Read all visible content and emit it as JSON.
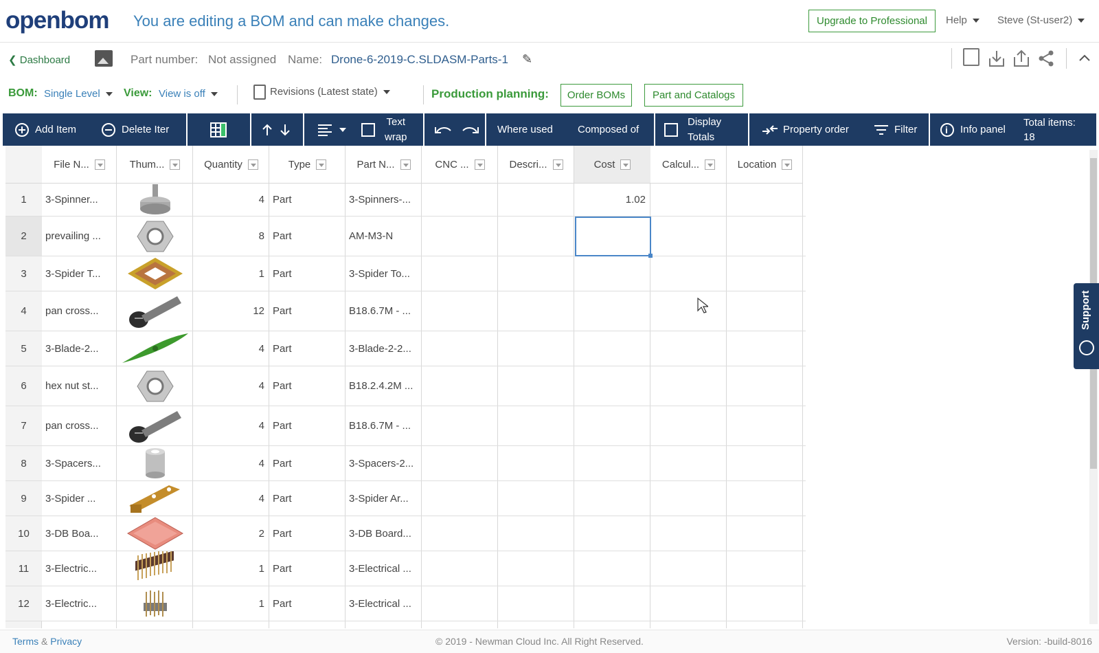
{
  "header": {
    "logo": "openbom",
    "message": "You are editing a BOM and can make changes.",
    "upgrade_label": "Upgrade to Professional",
    "help_label": "Help",
    "user_label": "Steve (St-user2)"
  },
  "info": {
    "dashboard_label": "Dashboard",
    "part_number_label": "Part number:",
    "part_number_value": "Not assigned",
    "name_label": "Name:",
    "name_value": "Drone-6-2019-C.SLDASM-Parts-1"
  },
  "controls": {
    "bom_label": "BOM:",
    "bom_value": "Single Level",
    "view_label": "View:",
    "view_value": "View is off",
    "revisions_label": "Revisions (Latest state)",
    "production_label": "Production planning:",
    "order_boms_label": "Order BOMs",
    "part_catalogs_label": "Part and Catalogs"
  },
  "toolbar": {
    "add_item": "Add Item",
    "delete_item": "Delete Iter",
    "text_wrap_1": "Text",
    "text_wrap_2": "wrap",
    "where_used": "Where used",
    "composed_of": "Composed of",
    "display_totals_1": "Display",
    "display_totals_2": "Totals",
    "property_order": "Property order",
    "filter": "Filter",
    "info_panel": "Info panel",
    "total_items_label": "Total items:",
    "total_items_value": "18"
  },
  "table": {
    "columns": [
      "File N...",
      "Thum...",
      "Quantity",
      "Type",
      "Part N...",
      "CNC ...",
      "Descri...",
      "Cost",
      "Calcul...",
      "Location"
    ],
    "rows": [
      {
        "num": "1",
        "file": "3-Spinner...",
        "qty": "4",
        "type": "Part",
        "part": "3-Spinners-...",
        "cost": "1.02",
        "thumb": "spinner"
      },
      {
        "num": "2",
        "file": "prevailing ...",
        "qty": "8",
        "type": "Part",
        "part": "AM-M3-N",
        "cost": "",
        "thumb": "nut"
      },
      {
        "num": "3",
        "file": "3-Spider T...",
        "qty": "1",
        "type": "Part",
        "part": "3-Spider To...",
        "cost": "",
        "thumb": "plate"
      },
      {
        "num": "4",
        "file": "pan cross...",
        "qty": "12",
        "type": "Part",
        "part": "B18.6.7M - ...",
        "cost": "",
        "thumb": "screw"
      },
      {
        "num": "5",
        "file": "3-Blade-2...",
        "qty": "4",
        "type": "Part",
        "part": "3-Blade-2-2...",
        "cost": "",
        "thumb": "blade"
      },
      {
        "num": "6",
        "file": "hex nut st...",
        "qty": "4",
        "type": "Part",
        "part": "B18.2.4.2M ...",
        "cost": "",
        "thumb": "nut"
      },
      {
        "num": "7",
        "file": "pan cross...",
        "qty": "4",
        "type": "Part",
        "part": "B18.6.7M - ...",
        "cost": "",
        "thumb": "screw"
      },
      {
        "num": "8",
        "file": "3-Spacers...",
        "qty": "4",
        "type": "Part",
        "part": "3-Spacers-2...",
        "cost": "",
        "thumb": "spacer"
      },
      {
        "num": "9",
        "file": "3-Spider ...",
        "qty": "4",
        "type": "Part",
        "part": "3-Spider Ar...",
        "cost": "",
        "thumb": "arm"
      },
      {
        "num": "10",
        "file": "3-DB Boa...",
        "qty": "2",
        "type": "Part",
        "part": "3-DB Board...",
        "cost": "",
        "thumb": "board"
      },
      {
        "num": "11",
        "file": "3-Electric...",
        "qty": "1",
        "type": "Part",
        "part": "3-Electrical ...",
        "cost": "",
        "thumb": "header"
      },
      {
        "num": "12",
        "file": "3-Electric...",
        "qty": "1",
        "type": "Part",
        "part": "3-Electrical ...",
        "cost": "",
        "thumb": "header2"
      }
    ]
  },
  "support_label": "Support",
  "footer": {
    "terms": "Terms",
    "and": "&",
    "privacy": "Privacy",
    "copyright": "© 2019 - Newman Cloud Inc. All Right Reserved.",
    "version": "Version: -build-8016"
  },
  "colors": {
    "toolbar_bg": "#1e3b63",
    "accent_green": "#3a9a3a",
    "link_blue": "#3a80b8",
    "selection": "#4a86c8"
  }
}
